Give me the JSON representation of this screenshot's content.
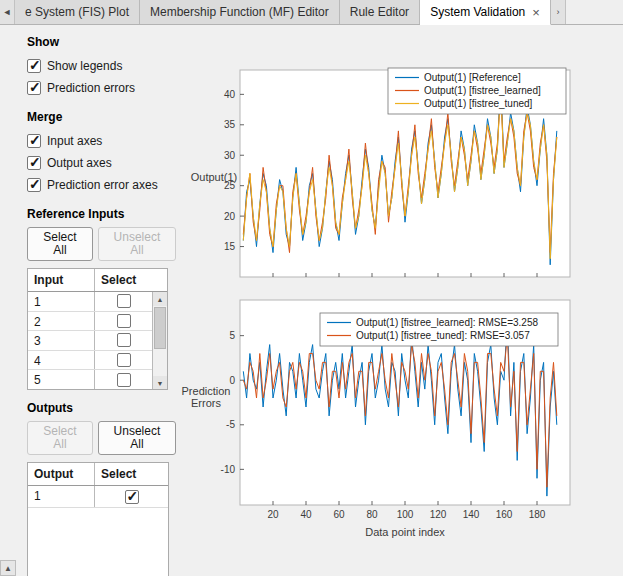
{
  "tabbar": {
    "scroll_left_icon": "◄",
    "scroll_right_icon": "›",
    "tabs": [
      {
        "label": "e System (FIS) Plot",
        "active": false
      },
      {
        "label": "Membership Function (MF) Editor",
        "active": false
      },
      {
        "label": "Rule Editor",
        "active": false
      },
      {
        "label": "System Validation",
        "active": true,
        "close_icon": "×"
      }
    ]
  },
  "sidebar": {
    "show": {
      "title": "Show",
      "items": [
        {
          "label": "Show legends",
          "checked": true
        },
        {
          "label": "Prediction errors",
          "checked": true
        }
      ]
    },
    "merge": {
      "title": "Merge",
      "items": [
        {
          "label": "Input axes",
          "checked": true
        },
        {
          "label": "Output axes",
          "checked": true
        },
        {
          "label": "Prediction error axes",
          "checked": true
        }
      ]
    },
    "reference_inputs": {
      "title": "Reference Inputs",
      "select_all": {
        "label": "Select All",
        "enabled": true
      },
      "unselect_all": {
        "label": "Unselect All",
        "enabled": false
      },
      "table": {
        "headers": [
          "Input",
          "Select"
        ],
        "rows": [
          {
            "label": "1",
            "checked": false
          },
          {
            "label": "2",
            "checked": false
          },
          {
            "label": "3",
            "checked": false
          },
          {
            "label": "4",
            "checked": false
          },
          {
            "label": "5",
            "checked": false
          }
        ],
        "scrollbar": {
          "up_icon": "▲",
          "down_icon": "▼"
        }
      }
    },
    "outputs": {
      "title": "Outputs",
      "select_all": {
        "label": "Select All",
        "enabled": false
      },
      "unselect_all": {
        "label": "Unselect All",
        "enabled": true
      },
      "table": {
        "headers": [
          "Output",
          "Select"
        ],
        "rows": [
          {
            "label": "1",
            "checked": true
          }
        ]
      }
    },
    "scroll_up_icon": "▲"
  },
  "chart_data": [
    {
      "type": "line",
      "title": "",
      "ylabel": "Output(1)",
      "xlabel": "",
      "x_start": 2,
      "x_step": 2,
      "xlim": [
        0,
        200
      ],
      "ylim": [
        10,
        44
      ],
      "yticks": [
        15,
        20,
        25,
        30,
        35,
        40
      ],
      "xticks": [
        20,
        40,
        60,
        80,
        100,
        120,
        140,
        160,
        180
      ],
      "show_x_tick_labels": false,
      "grid": false,
      "legend_position": "top-right",
      "series": [
        {
          "name": "Output(1) [Reference]",
          "color": "#0072BD",
          "values": [
            16,
            24,
            26,
            20,
            15,
            22,
            27,
            25,
            18,
            14,
            21,
            26,
            24,
            17,
            15,
            23,
            28,
            22,
            16,
            19,
            25,
            27,
            21,
            15,
            18,
            24,
            29,
            26,
            19,
            16,
            22,
            27,
            30,
            24,
            17,
            20,
            26,
            31,
            28,
            21,
            18,
            25,
            30,
            27,
            20,
            23,
            29,
            33,
            26,
            19,
            24,
            31,
            34,
            28,
            22,
            26,
            32,
            35,
            29,
            23,
            27,
            33,
            36,
            30,
            24,
            28,
            34,
            31,
            25,
            29,
            35,
            32,
            26,
            30,
            36,
            33,
            27,
            31,
            43,
            28,
            32,
            37,
            34,
            28,
            24,
            33,
            38,
            35,
            29,
            25,
            31,
            36,
            30,
            12,
            26,
            34
          ]
        },
        {
          "name": "Output(1) [fistree_learned]",
          "color": "#D95319",
          "values": [
            17,
            23,
            27,
            19,
            16,
            21,
            28,
            24,
            17,
            15,
            22,
            25,
            25,
            18,
            14,
            24,
            27,
            21,
            17,
            20,
            24,
            28,
            20,
            16,
            19,
            23,
            30,
            25,
            18,
            17,
            23,
            26,
            31,
            23,
            18,
            21,
            25,
            32,
            27,
            22,
            17,
            26,
            29,
            28,
            19,
            24,
            28,
            34,
            25,
            20,
            25,
            30,
            35,
            27,
            23,
            27,
            31,
            36,
            28,
            24,
            28,
            32,
            37,
            29,
            25,
            29,
            33,
            30,
            26,
            30,
            34,
            31,
            27,
            31,
            35,
            32,
            28,
            32,
            40,
            29,
            33,
            36,
            33,
            27,
            25,
            34,
            37,
            34,
            28,
            26,
            32,
            35,
            29,
            14,
            27,
            33
          ]
        },
        {
          "name": "Output(1) [fistree_tuned]",
          "color": "#EDB120",
          "values": [
            16,
            23,
            27,
            20,
            16,
            22,
            26,
            24,
            18,
            15,
            21,
            25,
            24,
            18,
            15,
            23,
            27,
            22,
            17,
            19,
            24,
            26,
            21,
            16,
            18,
            24,
            28,
            25,
            19,
            17,
            22,
            26,
            29,
            24,
            18,
            20,
            25,
            30,
            27,
            21,
            18,
            24,
            29,
            27,
            20,
            23,
            28,
            32,
            26,
            20,
            24,
            30,
            33,
            28,
            22,
            26,
            31,
            34,
            29,
            23,
            27,
            32,
            35,
            30,
            24,
            28,
            33,
            31,
            25,
            29,
            34,
            32,
            26,
            30,
            35,
            33,
            27,
            31,
            41,
            28,
            32,
            36,
            34,
            28,
            25,
            33,
            37,
            35,
            29,
            26,
            31,
            35,
            30,
            13,
            26,
            33
          ]
        }
      ]
    },
    {
      "type": "line",
      "title": "",
      "ylabel": "Prediction Errors",
      "xlabel": "Data point index",
      "x_start": 2,
      "x_step": 2,
      "xlim": [
        0,
        200
      ],
      "ylim": [
        -14,
        9
      ],
      "yticks": [
        -10,
        -5,
        0,
        5
      ],
      "xticks": [
        20,
        40,
        60,
        80,
        100,
        120,
        140,
        160,
        180
      ],
      "show_x_tick_labels": true,
      "grid": false,
      "legend_position": "top-center",
      "series": [
        {
          "name": "Output(1) [fistree_learned]: RMSE=3.258",
          "color": "#0072BD",
          "values": [
            1,
            -2,
            3,
            0,
            -1,
            2,
            -3,
            1,
            4,
            -2,
            0,
            3,
            -1,
            -4,
            2,
            1,
            -2,
            3,
            0,
            -3,
            2,
            4,
            -1,
            -2,
            1,
            3,
            -4,
            0,
            2,
            -1,
            3,
            -2,
            1,
            4,
            -3,
            0,
            2,
            -5,
            1,
            3,
            -2,
            0,
            4,
            -1,
            -3,
            2,
            1,
            -4,
            3,
            0,
            -2,
            5,
            1,
            -3,
            2,
            -1,
            4,
            0,
            -5,
            2,
            3,
            -2,
            -6,
            1,
            4,
            -1,
            -4,
            2,
            0,
            -7,
            3,
            1,
            -3,
            -8,
            2,
            4,
            -2,
            -5,
            1,
            0,
            7,
            -4,
            2,
            -9,
            1,
            3,
            -6,
            -2,
            4,
            -11,
            0,
            2,
            -13,
            -3,
            1,
            -5
          ]
        },
        {
          "name": "Output(1) [fistree_tuned]: RMSE=3.057",
          "color": "#D95319",
          "values": [
            0,
            -1,
            2,
            1,
            -2,
            3,
            -2,
            0,
            3,
            -1,
            1,
            2,
            -2,
            -3,
            1,
            2,
            -1,
            2,
            1,
            -2,
            3,
            3,
            0,
            -1,
            2,
            2,
            -3,
            1,
            1,
            -2,
            2,
            -1,
            2,
            3,
            -2,
            1,
            1,
            -4,
            2,
            2,
            -1,
            1,
            3,
            0,
            -2,
            3,
            0,
            -3,
            2,
            1,
            -1,
            4,
            2,
            -2,
            3,
            0,
            3,
            1,
            -4,
            1,
            2,
            -1,
            -5,
            2,
            3,
            0,
            -3,
            3,
            1,
            -6,
            2,
            2,
            -2,
            -7,
            3,
            3,
            -1,
            -4,
            2,
            1,
            5,
            -3,
            1,
            -8,
            2,
            2,
            -5,
            -1,
            3,
            -10,
            1,
            1,
            -12,
            -2,
            2,
            -4
          ]
        }
      ]
    }
  ]
}
